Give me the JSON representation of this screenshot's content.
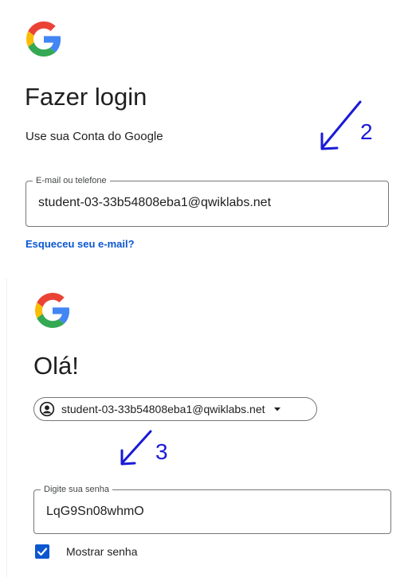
{
  "step2": {
    "title": "Fazer login",
    "subtitle": "Use sua Conta do Google",
    "email_field": {
      "label": "E-mail ou telefone",
      "value": "student-03-33b54808eba1@qwiklabs.net"
    },
    "forgot_link": "Esqueceu seu e-mail?",
    "annotation_number": "2"
  },
  "step3": {
    "title": "Olá!",
    "account_email": "student-03-33b54808eba1@qwiklabs.net",
    "password_field": {
      "label": "Digite sua senha",
      "value": "LqG9Sn08whmO"
    },
    "show_password": {
      "label": "Mostrar senha",
      "checked": true
    },
    "annotation_number": "3"
  },
  "colors": {
    "accent": "#0b57d0",
    "annotation": "#1a1ad8",
    "border": "#747775",
    "text": "#1f1f1f"
  },
  "icons": [
    "google-logo",
    "account-avatar-icon",
    "dropdown-caret-icon",
    "checkmark-icon",
    "annotation-arrow"
  ]
}
